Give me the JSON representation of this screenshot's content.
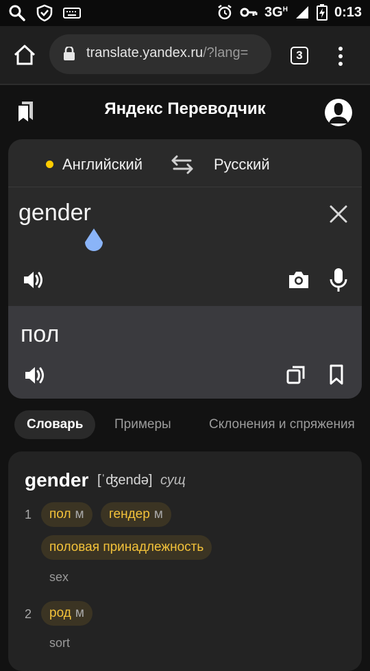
{
  "status": {
    "network": "3G",
    "network_sup": "H",
    "time": "0:13"
  },
  "browser": {
    "url_main": "translate.yandex.ru",
    "url_dim": "/?lang=",
    "tab_count": "3"
  },
  "app": {
    "title": "Яндекс Переводчик"
  },
  "translator": {
    "source_lang": "Английский",
    "target_lang": "Русский",
    "source_text": "gender",
    "target_text": "пол"
  },
  "tabs": [
    {
      "label": "Словарь",
      "active": true
    },
    {
      "label": "Примеры",
      "active": false
    },
    {
      "label": "Склонения и спряжения",
      "active": false
    }
  ],
  "dictionary": {
    "headword": "gender",
    "transcription": "[ˈʤendə]",
    "part_of_speech": "сущ",
    "senses": [
      {
        "number": "1",
        "translations": [
          {
            "word": "пол",
            "gender": "м"
          },
          {
            "word": "гендер",
            "gender": "м"
          },
          {
            "word": "половая принадлежность",
            "gender": ""
          }
        ],
        "gloss": "sex"
      },
      {
        "number": "2",
        "translations": [
          {
            "word": "род",
            "gender": "м"
          }
        ],
        "gloss": "sort"
      }
    ]
  },
  "colors": {
    "accent_yellow": "#ffcc00",
    "chip_text": "#f3c23a",
    "chip_bg": "#3b3423",
    "cursor_blue": "#8ab4f8"
  }
}
